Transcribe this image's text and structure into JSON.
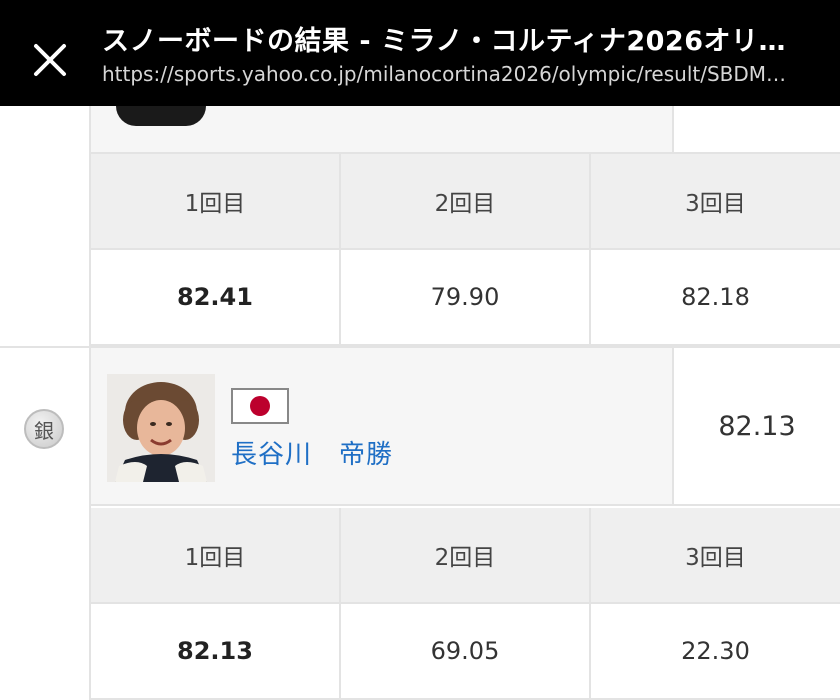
{
  "header": {
    "title": "スノーボードの結果 - ミラノ・コルティナ2026オリ…",
    "url": "https://sports.yahoo.co.jp/milanocortina2026/olympic/result/SBDM…"
  },
  "run_table_1": {
    "headers": [
      "1回目",
      "2回目",
      "3回目"
    ],
    "values": [
      "82.41",
      "79.90",
      "82.18"
    ]
  },
  "silver": {
    "medal": "銀",
    "name": "長谷川　帝勝",
    "score": "82.13",
    "flag_icon": "japan-flag-icon"
  },
  "run_table_2": {
    "headers": [
      "1回目",
      "2回目",
      "3回目"
    ],
    "values": [
      "82.13",
      "69.05",
      "22.30"
    ]
  },
  "colors": {
    "topbar": "#000000",
    "link": "#1f6fc5",
    "header_bg": "#efefef",
    "athlete_bg": "#f6f6f6"
  }
}
